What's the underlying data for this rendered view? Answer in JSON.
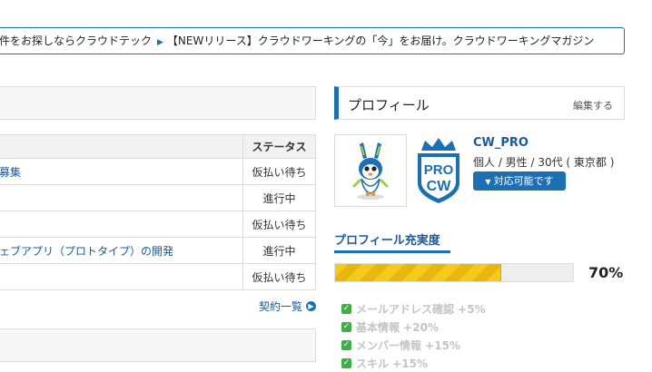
{
  "ticker": {
    "item1": "件をお探しならクラウドテック",
    "item2": "【NEWリリース】クラウドワーキングの「今」をお届け。クラウドワーキングマガジン"
  },
  "jobs": {
    "header_status": "ステータス",
    "rows": [
      {
        "title": "募集",
        "status": "仮払い待ち"
      },
      {
        "title": "",
        "status": "進行中"
      },
      {
        "title": "",
        "status": "仮払い待ち"
      },
      {
        "title": "ェブアプリ（プロトタイプ）の開発",
        "status": "進行中"
      },
      {
        "title": "",
        "status": "仮払い待ち"
      }
    ],
    "contracts_link": "契約一覧"
  },
  "profile": {
    "title": "プロフィール",
    "edit": "編集する",
    "badge_line1": "PRO",
    "badge_line2": "CW",
    "username": "CW_PRO",
    "info": "個人 / 男性 / 30代 ( 東京都 )",
    "availability": "対応可能です",
    "completeness_title": "プロフィール充実度",
    "completeness_percent_label": "70%",
    "completeness": 70,
    "checklist": [
      "メールアドレス確認 +5%",
      "基本情報 +20%",
      "メンバー情報 +15%",
      "スキル +15%"
    ]
  },
  "colors": {
    "accent": "#1a6fb5",
    "progress": "#f5cb1b",
    "check": "#3fae49"
  }
}
